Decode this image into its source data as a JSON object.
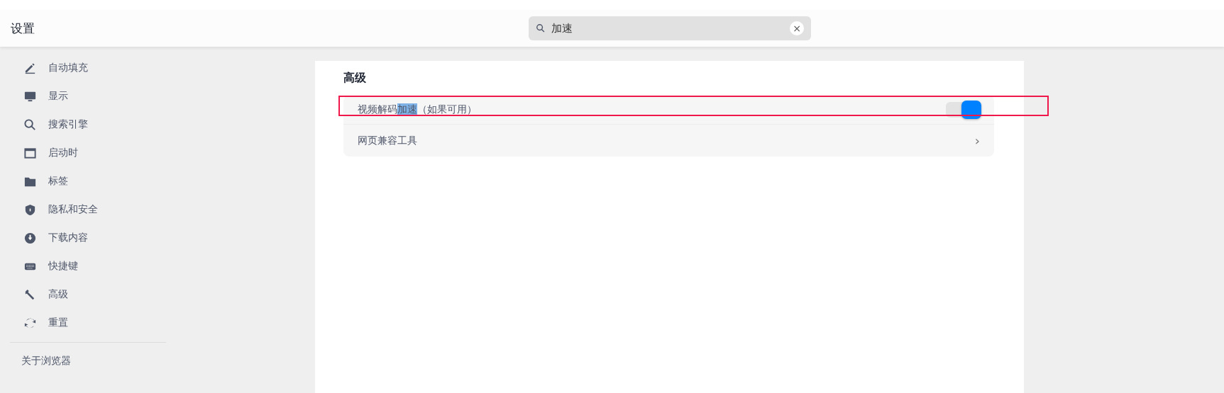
{
  "header": {
    "title": "设置",
    "search": {
      "value": "加速",
      "clear": "×"
    }
  },
  "sidebar": {
    "items": [
      {
        "label": "自动填充"
      },
      {
        "label": "显示"
      },
      {
        "label": "搜索引擎"
      },
      {
        "label": "启动时"
      },
      {
        "label": "标签"
      },
      {
        "label": "隐私和安全"
      },
      {
        "label": "下载内容"
      },
      {
        "label": "快捷键"
      },
      {
        "label": "高级"
      },
      {
        "label": "重置"
      }
    ],
    "footer": "关于浏览器"
  },
  "section": {
    "title": "高级",
    "rows": [
      {
        "kind": "toggle",
        "label_before": "视频解码",
        "match": "加速",
        "label_after": "（如果可用）",
        "on": true,
        "marked": true
      },
      {
        "kind": "link",
        "label": "网页兼容工具",
        "chevron": "›"
      }
    ]
  }
}
